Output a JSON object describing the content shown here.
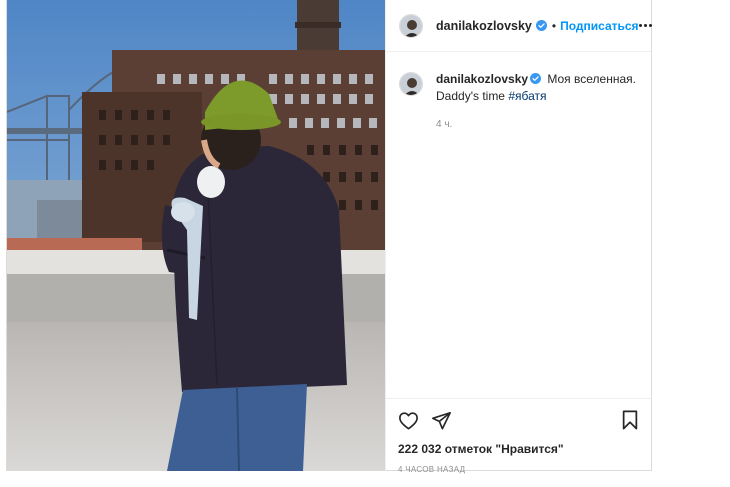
{
  "post": {
    "username": "danilakozlovsky",
    "follow_label": "Подписаться",
    "separator": "•",
    "caption_text": " Моя вселенная.",
    "caption_line2": "Daddy's time ",
    "hashtag": "#ябатя",
    "caption_time": "4 ч.",
    "likes": "222 032 отметок \"Нравится\"",
    "time_ago": "4 ЧАСОВ НАЗАД"
  },
  "icons": {
    "verified": "verified-badge-icon",
    "more": "more-options-icon",
    "like": "heart-icon",
    "share": "share-icon",
    "save": "bookmark-icon"
  },
  "colors": {
    "accent": "#0095f6",
    "verified": "#3897f0",
    "text": "#262626",
    "muted": "#8e8e8e",
    "hashtag": "#00376b"
  }
}
